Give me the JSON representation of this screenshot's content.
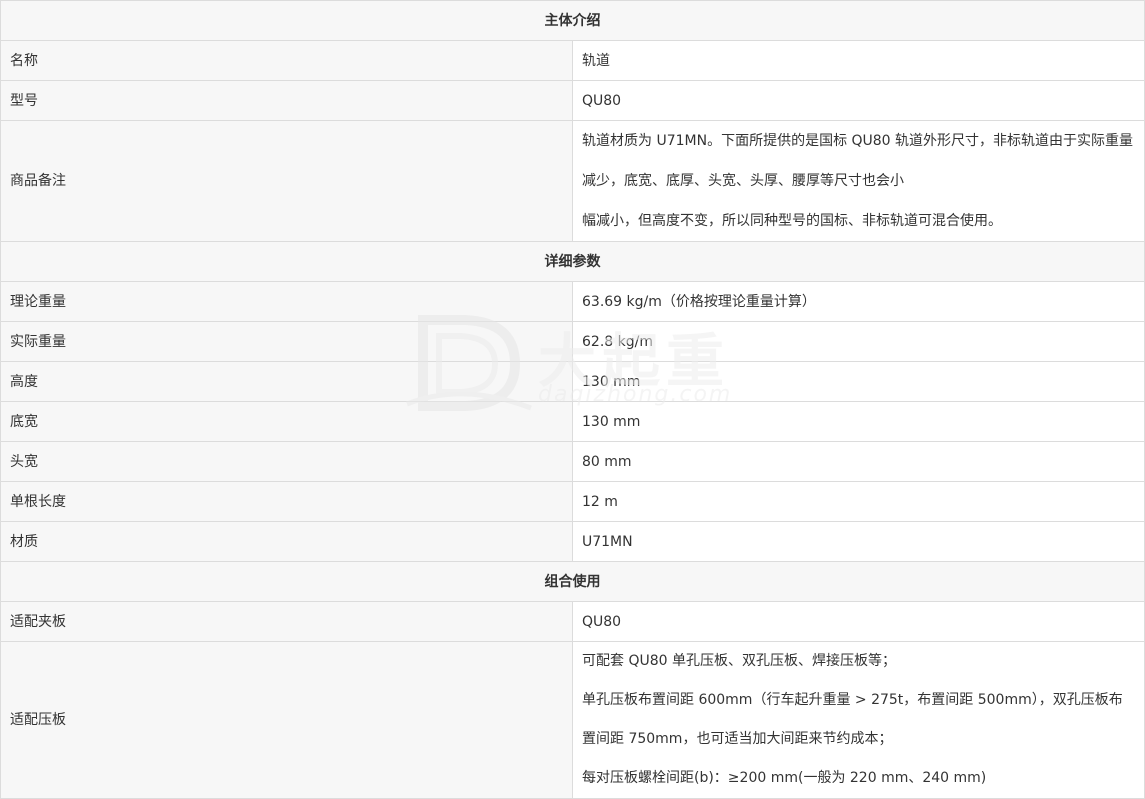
{
  "sections": {
    "intro": "主体介绍",
    "detail": "详细参数",
    "combo": "组合使用"
  },
  "intro_rows": {
    "name_label": "名称",
    "name_value": "轨道",
    "model_label": "型号",
    "model_value": "QU80",
    "note_label": "商品备注",
    "note_line1": "轨道材质为 U71MN。下面所提供的是国标 QU80 轨道外形尺寸，非标轨道由于实际重量减少，底宽、底厚、头宽、头厚、腰厚等尺寸也会小",
    "note_line2": "幅减小，但高度不变，所以同种型号的国标、非标轨道可混合使用。"
  },
  "detail_rows": {
    "theory_weight_label": "理论重量",
    "theory_weight_value": "63.69 kg/m（价格按理论重量计算）",
    "actual_weight_label": "实际重量",
    "actual_weight_value": "62.8 kg/m",
    "height_label": "高度",
    "height_value": "130 mm",
    "bottom_width_label": "底宽",
    "bottom_width_value": "130 mm",
    "head_width_label": "头宽",
    "head_width_value": "80 mm",
    "length_label": "单根长度",
    "length_value": "12 m",
    "material_label": "材质",
    "material_value": "U71MN"
  },
  "combo_rows": {
    "clamp_label": "适配夹板",
    "clamp_value": "QU80",
    "plate_label": "适配压板",
    "plate_line1": "可配套 QU80 单孔压板、双孔压板、焊接压板等；",
    "plate_line2": "单孔压板布置间距 600mm（行车起升重量 > 275t，布置间距 500mm），双孔压板布置间距 750mm，也可适当加大间距来节约成本；",
    "plate_line3": "每对压板螺栓间距(b)：≥200 mm(一般为 220 mm、240 mm)"
  },
  "watermark": {
    "brand_cn": "大起重",
    "brand_url": "daqizhong.com",
    "color": "#ededed"
  }
}
